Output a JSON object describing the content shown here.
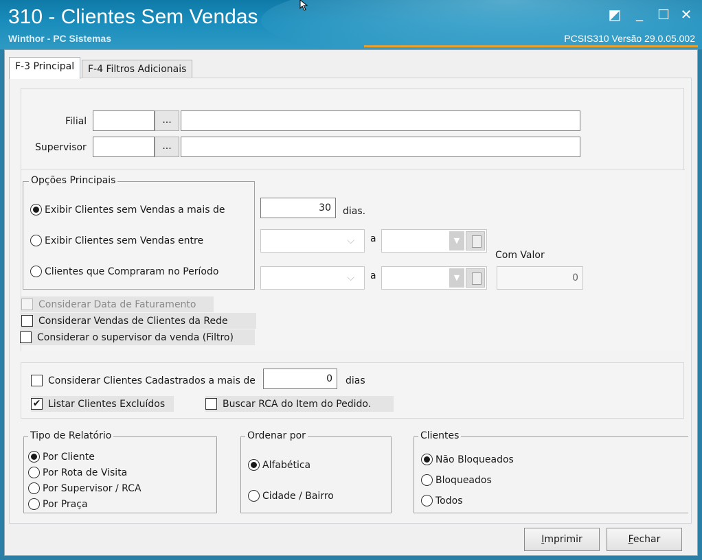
{
  "window": {
    "title": "310 - Clientes Sem Vendas",
    "subtitle": "Winthor - PC Sistemas",
    "version": "PCSIS310  Versão  29.0.05.002",
    "controls": {
      "restore": "◩",
      "minimize": "_",
      "maximize": "☐",
      "close": "✕"
    }
  },
  "tabs": [
    {
      "label": "F-3 Principal",
      "active": true
    },
    {
      "label": "F-4 Filtros Adicionais",
      "active": false
    }
  ],
  "filters": {
    "filial_label": "Filial",
    "supervisor_label": "Supervisor",
    "lookup_button": "..."
  },
  "opcoes_principais": {
    "title": "Opções Principais",
    "options": [
      {
        "label": "Exibir Clientes sem Vendas a mais de",
        "selected": true
      },
      {
        "label": "Exibir Clientes sem Vendas entre",
        "selected": false
      },
      {
        "label": "Clientes que Compraram no Período",
        "selected": false
      }
    ],
    "dias_value": "30",
    "dias_label": "dias.",
    "range_separator": "a",
    "com_valor_label": "Com Valor",
    "com_valor_value": "0"
  },
  "checkboxes_top": [
    {
      "label": "Considerar Data de Faturamento",
      "checked": false,
      "disabled": true
    },
    {
      "label": "Considerar Vendas de Clientes da Rede",
      "checked": false,
      "disabled": false
    },
    {
      "label": "Considerar o supervisor da venda (Filtro)",
      "checked": false,
      "disabled": false
    }
  ],
  "cadastrados": {
    "label": "Considerar Clientes Cadastrados a mais de",
    "value": "0",
    "suffix": "dias"
  },
  "listar_excluidos": {
    "label": "Listar Clientes Excluídos",
    "checked": true,
    "mark": "✔"
  },
  "buscar_rca": {
    "label": "Buscar RCA do Item do Pedido.",
    "checked": false
  },
  "tipo_relatorio": {
    "title": "Tipo de Relatório",
    "options": [
      {
        "label": "Por Cliente",
        "selected": true
      },
      {
        "label": "Por Rota de Visita",
        "selected": false
      },
      {
        "label": "Por Supervisor / RCA",
        "selected": false
      },
      {
        "label": "Por Praça",
        "selected": false
      }
    ]
  },
  "ordenar_por": {
    "title": "Ordenar por",
    "options": [
      {
        "label": "Alfabética",
        "selected": true
      },
      {
        "label": "Cidade / Bairro",
        "selected": false
      }
    ]
  },
  "clientes": {
    "title": "Clientes",
    "options": [
      {
        "label": "Não Bloqueados",
        "selected": true
      },
      {
        "label": "Bloqueados",
        "selected": false
      },
      {
        "label": "Todos",
        "selected": false
      }
    ]
  },
  "buttons": {
    "imprimir_accel": "I",
    "imprimir_rest": "mprimir",
    "fechar_accel": "F",
    "fechar_rest": "echar"
  }
}
